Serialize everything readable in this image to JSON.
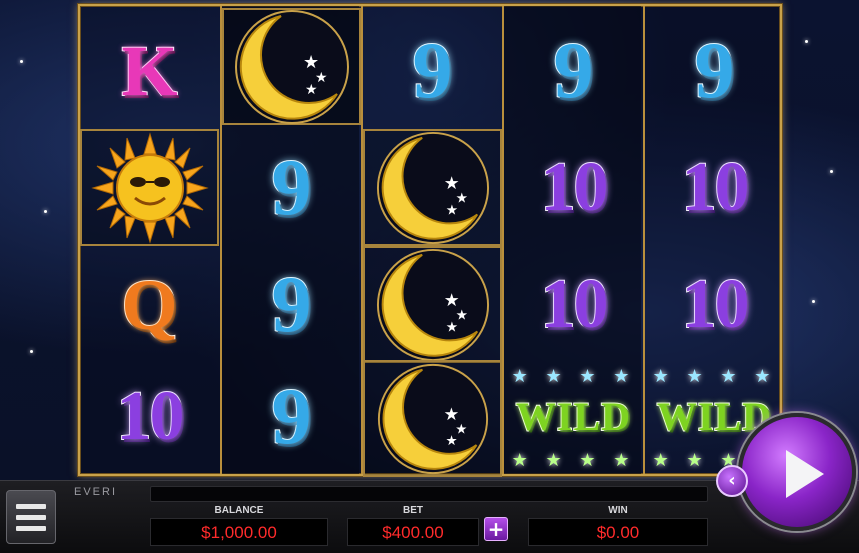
{
  "game": {
    "brand": "EVERI",
    "reels": [
      {
        "symbols": [
          "K",
          "sun",
          "Q",
          "10"
        ]
      },
      {
        "symbols": [
          "moon",
          "9",
          "9",
          "9"
        ]
      },
      {
        "symbols": [
          "9",
          "moon",
          "moon",
          "moon"
        ]
      },
      {
        "symbols": [
          "9",
          "10",
          "10",
          "WILD"
        ]
      },
      {
        "symbols": [
          "9",
          "10",
          "10",
          "WILD"
        ]
      }
    ],
    "wild_label": "WILD"
  },
  "meters": {
    "balance_label": "BALANCE",
    "balance_value": "$1,000.00",
    "bet_label": "BET",
    "bet_value": "$400.00",
    "win_label": "WIN",
    "win_value": "$0.00"
  },
  "controls": {
    "bet_plus_icon": "plus-icon",
    "spin_icon": "play-icon",
    "back_icon": "chevron-left-icon",
    "menu_icon": "hamburger-icon"
  },
  "colors": {
    "accent_purple": "#8a25c8",
    "meter_value": "#ff2b2b",
    "frame_gold": "#c9a24a"
  }
}
